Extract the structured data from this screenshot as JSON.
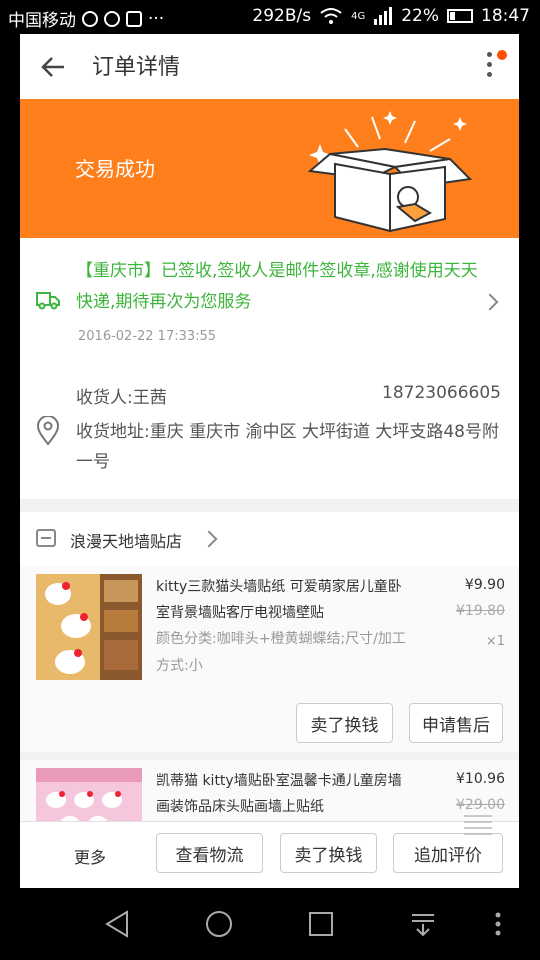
{
  "status_bar": {
    "carrier": "中国移动",
    "net_speed": "292B/s",
    "network_type": "4G",
    "battery": "22%",
    "time": "18:47",
    "icons": [
      "search-icon",
      "shield-icon",
      "camera-icon",
      "image-icon",
      "wifi-icon",
      "signal-icon",
      "battery-icon"
    ]
  },
  "header": {
    "title": "订单详情"
  },
  "banner": {
    "status": "交易成功",
    "color": "#ff7f1c"
  },
  "logistics": {
    "message": "【重庆市】已签收,签收人是邮件签收章,感谢使用天天快递,期待再次为您服务",
    "time": "2016-02-22 17:33:55",
    "color": "#3db53d"
  },
  "address": {
    "receiver": "收货人:王茜",
    "phone": "18723066605",
    "address": "收货地址:重庆 重庆市 渝中区 大坪街道 大坪支路48号附一号"
  },
  "shop": {
    "name": "浪漫天地墙贴店"
  },
  "items": [
    {
      "title": "kitty三款猫头墙贴纸 可爱萌家居儿童卧室背景墙贴客厅电视墙壁贴",
      "price": "¥9.90",
      "original_price": "¥19.80",
      "quantity": "×1",
      "spec": "颜色分类:咖啡头+橙黄蝴蝶结;尺寸/加工方式:小",
      "buttons": [
        "卖了换钱",
        "申请售后"
      ]
    },
    {
      "title": "凯蒂猫 kitty墙贴卧室温馨卡通儿童房墙画装饰品床头贴画墙上贴纸",
      "price": "¥10.96",
      "original_price": "¥29.00"
    }
  ],
  "bottom_bar": {
    "more": "更多",
    "buttons": [
      "查看物流",
      "卖了换钱",
      "追加评价"
    ]
  }
}
